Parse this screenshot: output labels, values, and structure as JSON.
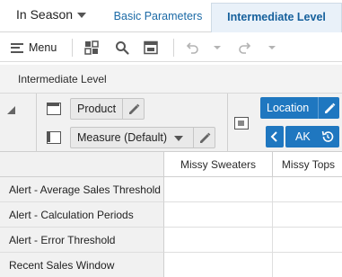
{
  "header": {
    "plan_selector": "In Season",
    "tabs": [
      {
        "label": "Basic Parameters"
      },
      {
        "label": "Intermediate Level"
      }
    ]
  },
  "toolbar": {
    "menu_label": "Menu",
    "icons": [
      "pivot-icon",
      "search-icon",
      "view-icon",
      "undo-icon",
      "redo-icon"
    ]
  },
  "pane": {
    "title": "Intermediate Level"
  },
  "pivot": {
    "row_dimensions": [
      {
        "label": "Product"
      },
      {
        "label": "Measure (Default)"
      }
    ],
    "column_dimension": {
      "label": "Location"
    },
    "page_member": {
      "label": "AK"
    }
  },
  "grid": {
    "columns": [
      "Missy Sweaters",
      "Missy Tops"
    ],
    "rows": [
      "Alert - Average Sales Threshold",
      "Alert - Calculation Periods",
      "Alert - Error Threshold",
      "Recent Sales Window"
    ]
  },
  "colors": {
    "accent": "#1f77c0",
    "tab_text": "#1c6aa6",
    "header_bg": "#f1f1f1"
  }
}
